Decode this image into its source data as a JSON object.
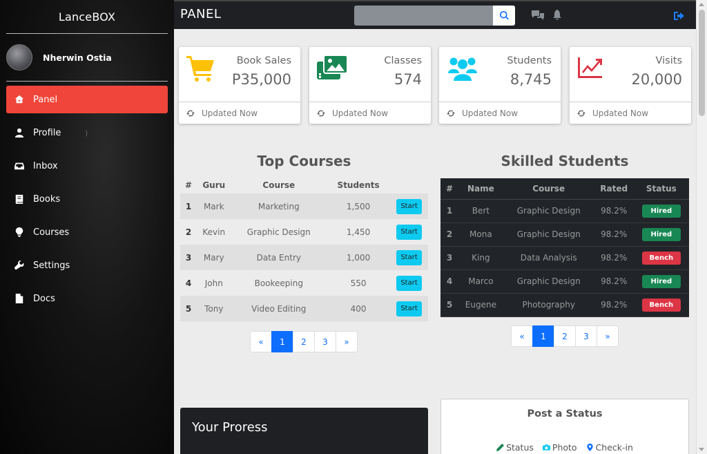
{
  "sidebar": {
    "brand": "LanceBOX",
    "user_name": "Nherwin Ostia",
    "items": [
      {
        "label": "Panel",
        "icon": "home-icon"
      },
      {
        "label": "Profile",
        "icon": "user-icon"
      },
      {
        "label": "Inbox",
        "icon": "inbox-icon"
      },
      {
        "label": "Books",
        "icon": "book-icon"
      },
      {
        "label": "Courses",
        "icon": "lightbulb-icon"
      },
      {
        "label": "Settings",
        "icon": "wrench-icon"
      },
      {
        "label": "Docs",
        "icon": "file-icon"
      }
    ],
    "profile_caret": ")"
  },
  "topbar": {
    "title": "PANEL",
    "search_placeholder": ""
  },
  "cards": [
    {
      "label": "Book Sales",
      "value": "P35,000",
      "footer": "Updated Now",
      "icon": "cart-icon",
      "color": "#ffc107"
    },
    {
      "label": "Classes",
      "value": "574",
      "footer": "Updated Now",
      "icon": "images-icon",
      "color": "#198754"
    },
    {
      "label": "Students",
      "value": "8,745",
      "footer": "Updated Now",
      "icon": "users-icon",
      "color": "#0dcaf0"
    },
    {
      "label": "Visits",
      "value": "20,000",
      "footer": "Updated Now",
      "icon": "chart-line-icon",
      "color": "#dc3545"
    }
  ],
  "top_courses": {
    "title": "Top Courses",
    "headers": [
      "#",
      "Guru",
      "Course",
      "Students",
      ""
    ],
    "rows": [
      {
        "num": "1",
        "guru": "Mark",
        "course": "Marketing",
        "students": "1,500",
        "action": "Start"
      },
      {
        "num": "2",
        "guru": "Kevin",
        "course": "Graphic Design",
        "students": "1,450",
        "action": "Start"
      },
      {
        "num": "3",
        "guru": "Mary",
        "course": "Data Entry",
        "students": "1,000",
        "action": "Start"
      },
      {
        "num": "4",
        "guru": "John",
        "course": "Bookeeping",
        "students": "550",
        "action": "Start"
      },
      {
        "num": "5",
        "guru": "Tony",
        "course": "Video Editing",
        "students": "400",
        "action": "Start"
      }
    ],
    "pagination": [
      "«",
      "1",
      "2",
      "3",
      "»"
    ]
  },
  "skilled_students": {
    "title": "Skilled Students",
    "headers": [
      "#",
      "Name",
      "Course",
      "Rated",
      "Status"
    ],
    "rows": [
      {
        "num": "1",
        "name": "Bert",
        "course": "Graphic Design",
        "rated": "98.2%",
        "status": "Hired"
      },
      {
        "num": "2",
        "name": "Mona",
        "course": "Graphic Design",
        "rated": "98.2%",
        "status": "Hired"
      },
      {
        "num": "3",
        "name": "King",
        "course": "Data Analysis",
        "rated": "98.2%",
        "status": "Bench"
      },
      {
        "num": "4",
        "name": "Marco",
        "course": "Graphic Design",
        "rated": "98.2%",
        "status": "Hired"
      },
      {
        "num": "5",
        "name": "Eugene",
        "course": "Photography",
        "rated": "98.2%",
        "status": "Bench"
      }
    ],
    "pagination": [
      "«",
      "1",
      "2",
      "3",
      "»"
    ]
  },
  "progress": {
    "title": "Your Proress"
  },
  "post": {
    "title": "Post a Status",
    "actions": [
      {
        "label": "Status",
        "icon": "pencil-icon",
        "color": "#198754"
      },
      {
        "label": "Photo",
        "icon": "camera-icon",
        "color": "#0dcaf0"
      },
      {
        "label": "Check-in",
        "icon": "map-pin-icon",
        "color": "#0d6efd"
      }
    ]
  },
  "colors": {
    "accent": "#f0453a",
    "primary": "#0d6efd",
    "info": "#0dcaf0",
    "success": "#198754",
    "danger": "#dc3545"
  }
}
